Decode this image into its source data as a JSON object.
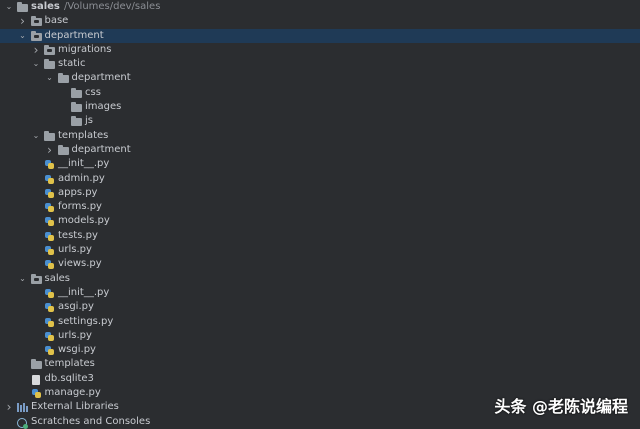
{
  "tree": [
    {
      "label": "sales",
      "sub": "/Volumes/dev/sales",
      "depth": 0,
      "chevron": "open",
      "icon": "folder",
      "bold": true
    },
    {
      "label": "base",
      "depth": 1,
      "chevron": "closed",
      "icon": "package-folder"
    },
    {
      "label": "department",
      "depth": 1,
      "chevron": "open",
      "icon": "package-folder",
      "selected": true
    },
    {
      "label": "migrations",
      "depth": 2,
      "chevron": "closed",
      "icon": "package-folder"
    },
    {
      "label": "static",
      "depth": 2,
      "chevron": "open",
      "icon": "folder"
    },
    {
      "label": "department",
      "depth": 3,
      "chevron": "open",
      "icon": "folder"
    },
    {
      "label": "css",
      "depth": 4,
      "chevron": "none",
      "icon": "folder"
    },
    {
      "label": "images",
      "depth": 4,
      "chevron": "none",
      "icon": "folder"
    },
    {
      "label": "js",
      "depth": 4,
      "chevron": "none",
      "icon": "folder"
    },
    {
      "label": "templates",
      "depth": 2,
      "chevron": "open",
      "icon": "folder"
    },
    {
      "label": "department",
      "depth": 3,
      "chevron": "closed",
      "icon": "folder"
    },
    {
      "label": "__init__.py",
      "depth": 2,
      "chevron": "none",
      "icon": "python-file"
    },
    {
      "label": "admin.py",
      "depth": 2,
      "chevron": "none",
      "icon": "python-file"
    },
    {
      "label": "apps.py",
      "depth": 2,
      "chevron": "none",
      "icon": "python-file"
    },
    {
      "label": "forms.py",
      "depth": 2,
      "chevron": "none",
      "icon": "python-file"
    },
    {
      "label": "models.py",
      "depth": 2,
      "chevron": "none",
      "icon": "python-file"
    },
    {
      "label": "tests.py",
      "depth": 2,
      "chevron": "none",
      "icon": "python-file"
    },
    {
      "label": "urls.py",
      "depth": 2,
      "chevron": "none",
      "icon": "python-file"
    },
    {
      "label": "views.py",
      "depth": 2,
      "chevron": "none",
      "icon": "python-file"
    },
    {
      "label": "sales",
      "depth": 1,
      "chevron": "open",
      "icon": "package-folder"
    },
    {
      "label": "__init__.py",
      "depth": 2,
      "chevron": "none",
      "icon": "python-file"
    },
    {
      "label": "asgi.py",
      "depth": 2,
      "chevron": "none",
      "icon": "python-file"
    },
    {
      "label": "settings.py",
      "depth": 2,
      "chevron": "none",
      "icon": "python-file"
    },
    {
      "label": "urls.py",
      "depth": 2,
      "chevron": "none",
      "icon": "python-file"
    },
    {
      "label": "wsgi.py",
      "depth": 2,
      "chevron": "none",
      "icon": "python-file"
    },
    {
      "label": "templates",
      "depth": 1,
      "chevron": "none",
      "icon": "folder"
    },
    {
      "label": "db.sqlite3",
      "depth": 1,
      "chevron": "none",
      "icon": "database-file"
    },
    {
      "label": "manage.py",
      "depth": 1,
      "chevron": "none",
      "icon": "python-file"
    },
    {
      "label": "External Libraries",
      "depth": 0,
      "chevron": "closed",
      "icon": "library"
    },
    {
      "label": "Scratches and Consoles",
      "depth": 0,
      "chevron": "none",
      "icon": "scratches"
    }
  ],
  "watermark": "头条 @老陈说编程"
}
